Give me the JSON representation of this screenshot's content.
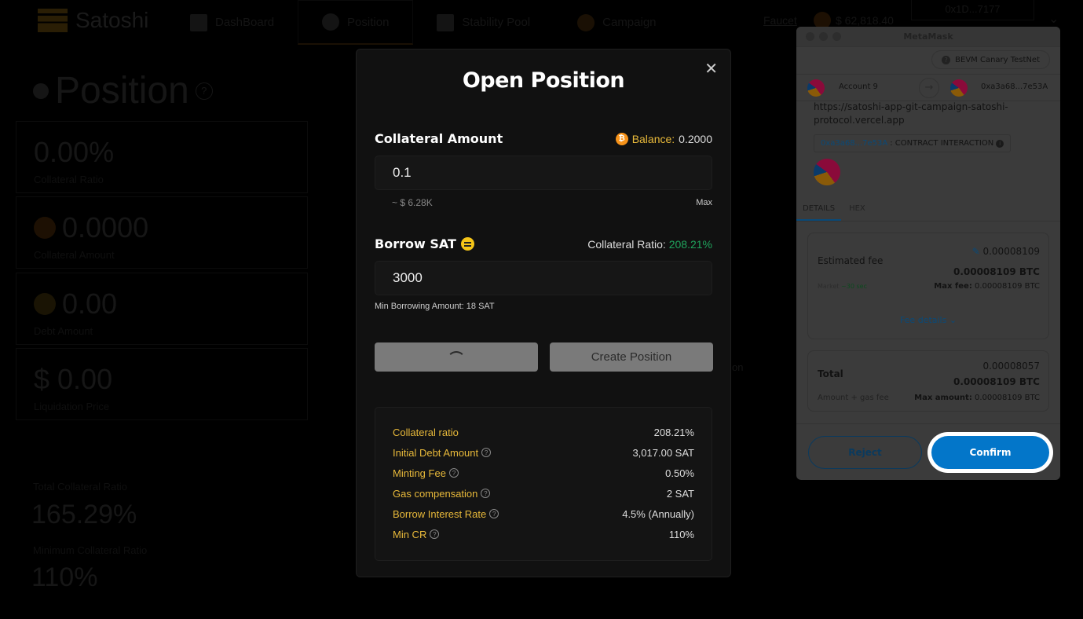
{
  "app": {
    "logo_text": "Satoshi",
    "nav": [
      {
        "label": "DashBoard",
        "icon": "dashboard-icon"
      },
      {
        "label": "Position",
        "icon": "position-icon"
      },
      {
        "label": "Stability Pool",
        "icon": "stability-pool-icon"
      },
      {
        "label": "Campaign",
        "icon": "campaign-icon"
      }
    ],
    "faucet": "Faucet",
    "btc_price": "$ 62,818.40",
    "wallet_address": "0x1D...7177",
    "page_title": "Position",
    "stats": [
      {
        "value": "0.00%",
        "label": "Collateral Ratio"
      },
      {
        "value": "0.0000",
        "label": "Collateral Amount"
      },
      {
        "value": "0.00",
        "label": "Debt Amount"
      },
      {
        "value": "$ 0.00",
        "label": "Liquidation Price"
      }
    ],
    "total_cr_label": "Total Collateral Ratio",
    "total_cr_value": "165.29%",
    "min_cr_label": "Minimum Collateral Ratio",
    "min_cr_value": "110%",
    "hidden_text_fragment": "on"
  },
  "modal": {
    "title": "Open Position",
    "collateral_label": "Collateral Amount",
    "balance_label": "Balance:",
    "balance_value": "0.2000",
    "collateral_value": "0.1",
    "collateral_usd": "~ $ 6.28K",
    "max_label": "Max",
    "borrow_label": "Borrow SAT",
    "cr_label": "Collateral Ratio:",
    "cr_value": "208.21%",
    "borrow_value": "3000",
    "min_borrow": "Min Borrowing Amount: 18 SAT",
    "create_label": "Create Position",
    "info": [
      {
        "key": "Collateral ratio",
        "value": "208.21%",
        "help": false
      },
      {
        "key": "Initial Debt Amount",
        "value": "3,017.00 SAT",
        "help": true
      },
      {
        "key": "Minting Fee",
        "value": "0.50%",
        "help": true
      },
      {
        "key": "Gas compensation",
        "value": "2 SAT",
        "help": true
      },
      {
        "key": "Borrow Interest Rate",
        "value": "4.5% (Annually)",
        "help": true
      },
      {
        "key": "Min CR",
        "value": "110%",
        "help": true
      }
    ],
    "colors": {
      "accent": "#e8b93a",
      "positive": "#1fa35c"
    }
  },
  "metamask": {
    "title": "MetaMask",
    "network": "BEVM Canary TestNet",
    "from_account": "Account 9",
    "to_address": "0xa3a68...7e53A",
    "origin": "https://satoshi-app-git-campaign-satoshi-protocol.vercel.app",
    "contract_address": "0xa3a68...7e53A",
    "contract_label": ": CONTRACT INTERACTION",
    "tabs": [
      "DETAILS",
      "HEX"
    ],
    "estimated_fee_label": "Estimated fee",
    "estimated_fee": "0.00008109",
    "estimated_fee_btc": "0.00008109 BTC",
    "market_label": "Market",
    "market_time": "~30 sec",
    "max_fee_label": "Max fee:",
    "max_fee": "0.00008109 BTC",
    "fee_details": "Fee details",
    "total_label": "Total",
    "total_amount": "0.00008057",
    "total_btc": "0.00008109 BTC",
    "amount_gas_label": "Amount + gas fee",
    "max_amount_label": "Max amount:",
    "max_amount": "0.00008109 BTC",
    "reject_label": "Reject",
    "confirm_label": "Confirm",
    "colors": {
      "confirm": "#0376c9"
    }
  }
}
